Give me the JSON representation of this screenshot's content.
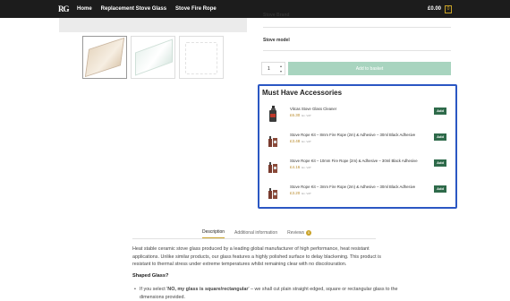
{
  "header": {
    "logo_text": "RG",
    "nav": [
      "Home",
      "Replacement Stove Glass",
      "Stove Fire Rope"
    ],
    "cart_total": "£0.00",
    "cart_count": "0"
  },
  "product": {
    "stove_brand_label": "Stove Brand",
    "stove_model_label": "Stove model",
    "quantity": "1",
    "add_to_basket": "Add to basket"
  },
  "accessories": {
    "title": "Must Have Accessories",
    "items": [
      {
        "name": "Vitcas Stove Glass Cleaner",
        "price": "£6.30",
        "vat": "Ex. VAT",
        "add": "Add",
        "icon": "spray-bottle-icon"
      },
      {
        "name": "Stove Rope Kit – 8mm Fire Rope (2m) & Adhesive – 30ml Black Adhesive",
        "price": "£3.48",
        "vat": "Ex. VAT",
        "add": "Add",
        "icon": "adhesive-bottle-icon"
      },
      {
        "name": "Stove Rope Kit – 10mm Fire Rope (2m) & Adhesive – 30ml Black Adhesive",
        "price": "£4.16",
        "vat": "Ex. VAT",
        "add": "Add",
        "icon": "adhesive-bottle-icon"
      },
      {
        "name": "Stove Rope Kit – 3mm Fire Rope (2m) & Adhesive – 30ml Black Adhesive",
        "price": "£3.20",
        "vat": "Ex. VAT",
        "add": "Add",
        "icon": "adhesive-bottle-icon"
      }
    ]
  },
  "tabs": {
    "description": "Description",
    "additional": "Additional information",
    "reviews": "Reviews",
    "reviews_count": "0"
  },
  "description": {
    "text": "Heat stable ceramic stove glass produced by a leading global manufacturer of high performance, heat resistant applications. Unlike similar products, our glass features a highly polished surface to delay blackening. This product is resistant to thermal stress under extreme temperatures whilst remaining clear with no discolouration.",
    "shaped_heading": "Shaped Glass?",
    "bullet_prefix": "If you select '",
    "bullet_strong": "NO, my glass is square/rectangular",
    "bullet_suffix": "' – we shall cut plain straight edged, square or rectangular glass to the dimensions provided."
  },
  "colors": {
    "topbar": "#1c1c1c",
    "accent_gold": "#c9a227",
    "add_button": "#2e6a4a",
    "basket_button": "#a8d4bf",
    "highlight_border": "#2b57c3"
  }
}
